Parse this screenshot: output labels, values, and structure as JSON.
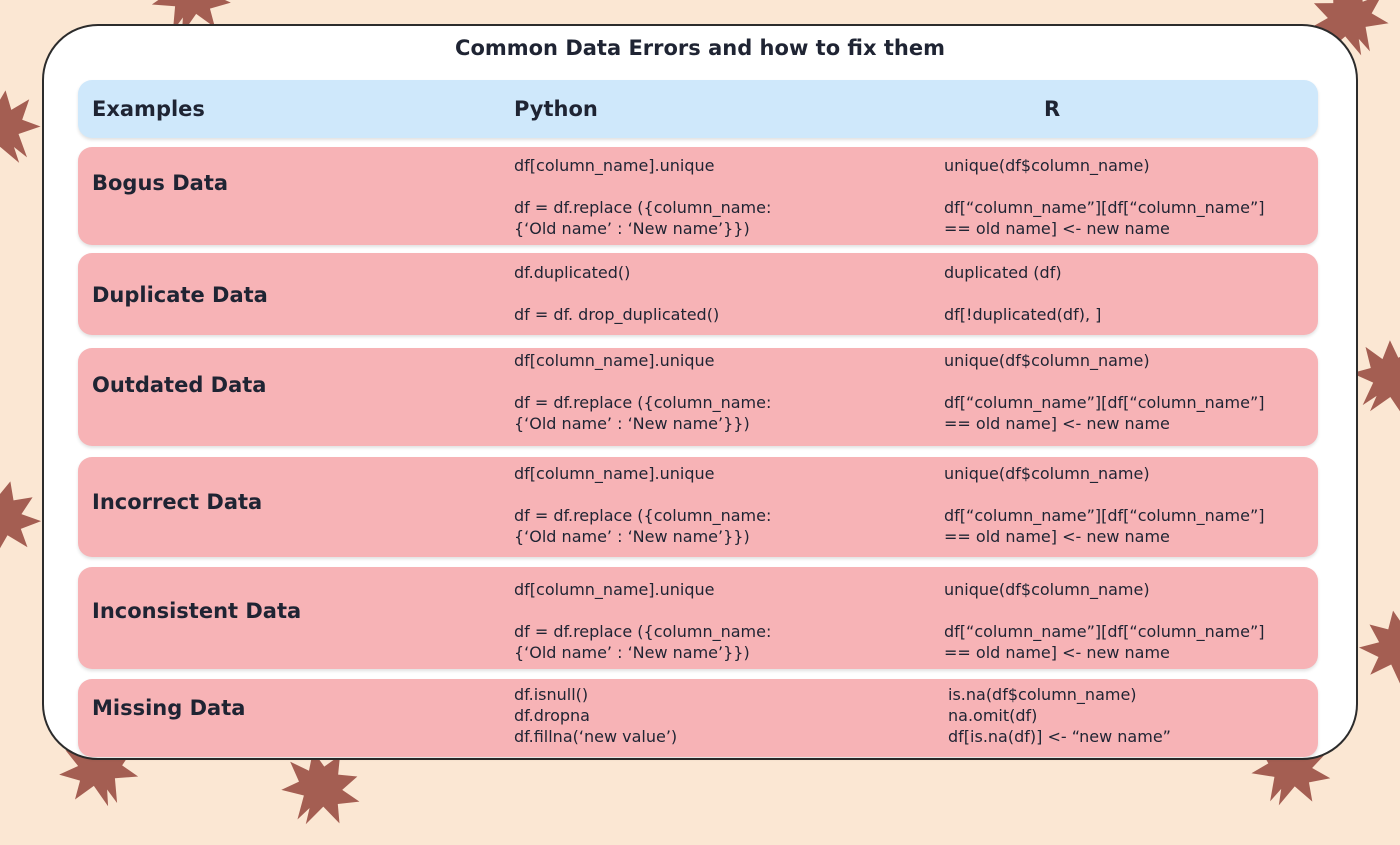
{
  "title": "Common Data Errors and how to fix them",
  "columns": {
    "examples": "Examples",
    "python": "Python",
    "r": "R"
  },
  "rows": [
    {
      "label": "Bogus Data",
      "python_1": "df[column_name].unique",
      "python_2": "df = df.replace ({column_name:\n{‘Old name’ : ‘New name’}})",
      "r_1": "unique(df$column_name)",
      "r_2": "df[“column_name”][df[“column_name”]\n== old name] <- new name"
    },
    {
      "label": "Duplicate Data",
      "python_1": "df.duplicated()",
      "python_2": "df = df. drop_duplicated()",
      "r_1": "duplicated (df)",
      "r_2": "df[!duplicated(df), ]"
    },
    {
      "label": "Outdated Data",
      "python_1": "df[column_name].unique",
      "python_2": "df = df.replace ({column_name:\n{‘Old name’ : ‘New name’}})",
      "r_1": "unique(df$column_name)",
      "r_2": "df[“column_name”][df[“column_name”]\n== old name] <- new name"
    },
    {
      "label": "Incorrect Data",
      "python_1": "df[column_name].unique",
      "python_2": "df = df.replace ({column_name:\n{‘Old name’ : ‘New name’}})",
      "r_1": "unique(df$column_name)",
      "r_2": "df[“column_name”][df[“column_name”]\n== old name] <- new name"
    },
    {
      "label": "Inconsistent Data",
      "python_1": "df[column_name].unique",
      "python_2": "df = df.replace ({column_name:\n{‘Old name’ : ‘New name’}})",
      "r_1": "unique(df$column_name)",
      "r_2": "df[“column_name”][df[“column_name”]\n== old name] <- new name"
    },
    {
      "label": "Missing Data",
      "python_1": "df.isnull()\ndf.dropna\ndf.fillna(‘new value’)",
      "python_2": "",
      "r_1": "is.na(df$column_name)\nna.omit(df)\ndf[is.na(df)] <- “new name”",
      "r_2": ""
    }
  ],
  "colors": {
    "background": "#fbe7d3",
    "header": "#cfe8fb",
    "row": "#f7b3b6",
    "leaf": "#9a4f44",
    "text": "#1f2433"
  }
}
